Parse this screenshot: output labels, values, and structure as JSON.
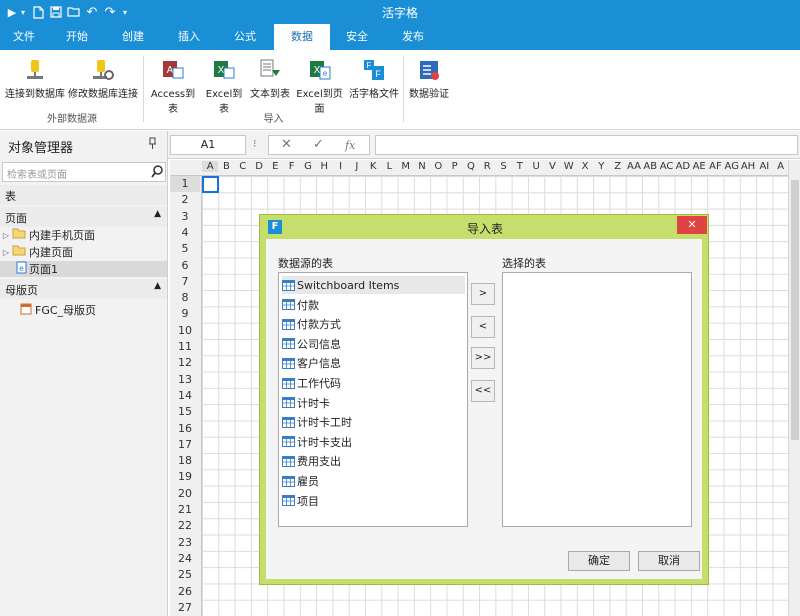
{
  "app": {
    "title": "活字格"
  },
  "quick_access": [
    {
      "icon": "play-icon",
      "glyph": "▶"
    },
    {
      "icon": "dropdown-icon",
      "glyph": "▾"
    },
    {
      "icon": "new-file-icon",
      "glyph": ""
    },
    {
      "icon": "save-icon",
      "glyph": ""
    },
    {
      "icon": "open-folder-icon",
      "glyph": ""
    },
    {
      "icon": "undo-icon",
      "glyph": "↶"
    },
    {
      "icon": "redo-icon",
      "glyph": "↷"
    },
    {
      "icon": "customize-icon",
      "glyph": "▾"
    }
  ],
  "tabs": [
    "文件",
    "开始",
    "创建",
    "插入",
    "公式",
    "数据",
    "安全",
    "发布"
  ],
  "active_tab": "数据",
  "ribbon": {
    "groups": {
      "external": "外部数据源",
      "import": "导入"
    },
    "buttons": {
      "connect_db": "连接到数据库",
      "modify_db": "修改数据库连接",
      "access_to_table": "Access到表",
      "excel_to_table": "Excel到表",
      "text_to_table": "文本到表",
      "excel_to_page": "Excel到页面",
      "hzg_file": "活字格文件",
      "data_validation": "数据验证"
    }
  },
  "left_panel": {
    "title": "对象管理器",
    "search_placeholder": "检索表或页面",
    "sections": {
      "table": "表",
      "page": "页面",
      "master": "母版页"
    },
    "pages": [
      {
        "label": "内建手机页面",
        "type": "folder"
      },
      {
        "label": "内建页面",
        "type": "folder"
      },
      {
        "label": "页面1",
        "type": "page"
      }
    ],
    "masters": [
      {
        "label": "FGC_母版页"
      }
    ]
  },
  "formula_bar": {
    "cell_ref": "A1",
    "dots": "⁝",
    "cancel": "✕",
    "confirm": "✓",
    "fx": "fx",
    "value": ""
  },
  "sheet": {
    "columns": [
      "A",
      "B",
      "C",
      "D",
      "E",
      "F",
      "G",
      "H",
      "I",
      "J",
      "K",
      "L",
      "M",
      "N",
      "O",
      "P",
      "Q",
      "R",
      "S",
      "T",
      "U",
      "V",
      "W",
      "X",
      "Y",
      "Z",
      "AA",
      "AB",
      "AC",
      "AD",
      "AE",
      "AF",
      "AG",
      "AH",
      "AI",
      "A"
    ],
    "rows": [
      "1",
      "2",
      "3",
      "4",
      "5",
      "6",
      "7",
      "8",
      "9",
      "10",
      "11",
      "12",
      "13",
      "14",
      "15",
      "16",
      "17",
      "18",
      "19",
      "20",
      "21",
      "22",
      "23",
      "24",
      "25",
      "26",
      "27"
    ]
  },
  "dialog": {
    "title": "导入表",
    "logo": "F",
    "close": "✕",
    "source_label": "数据源的表",
    "selected_label": "选择的表",
    "source_tables": [
      "Switchboard Items",
      "付款",
      "付款方式",
      "公司信息",
      "客户信息",
      "工作代码",
      "计时卡",
      "计时卡工时",
      "计时卡支出",
      "费用支出",
      "雇员",
      "项目"
    ],
    "selected_tables": [],
    "move_buttons": {
      "add": ">",
      "remove": "<",
      "add_all": ">>",
      "remove_all": "<<"
    },
    "ok": "确定",
    "cancel": "取消"
  },
  "colors": {
    "titlebar": "#1b8fd6",
    "dialog_frame": "#c6de6b",
    "close_button": "#e04343",
    "active_cell": "#1b6fd6"
  }
}
